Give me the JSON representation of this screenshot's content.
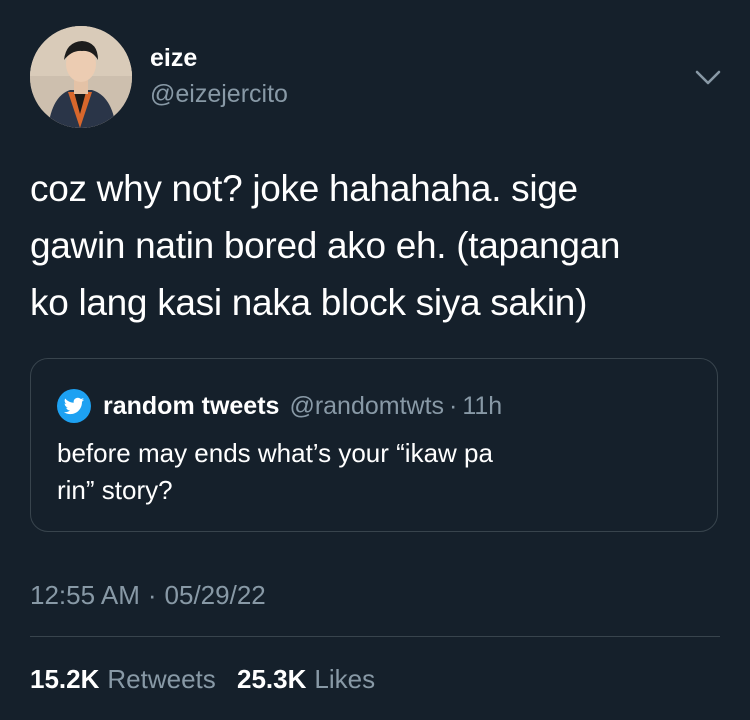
{
  "author": {
    "name": "eize",
    "handle": "@eizejercito"
  },
  "tweet": {
    "lines": [
      "coz why not? joke hahahaha. sige",
      "gawin natin bored ako eh. (tapangan",
      "ko lang kasi naka block siya sakin)"
    ]
  },
  "quoted": {
    "name": "random tweets",
    "handle": "@randomtwts",
    "separator": "·",
    "time": "11h",
    "lines": [
      "before may ends what’s your “ikaw pa",
      "rin” story?"
    ]
  },
  "meta": {
    "time": "12:55 AM",
    "separator": "·",
    "date": "05/29/22"
  },
  "stats": {
    "retweets_count": "15.2K",
    "retweets_label": "Retweets",
    "likes_count": "25.3K",
    "likes_label": "Likes"
  },
  "icons": {
    "more": "chevron-down-icon",
    "quote_avatar": "twitter-bird-icon"
  },
  "colors": {
    "background": "#15202b",
    "secondary_text": "#8899a6",
    "border": "#38444d",
    "accent": "#1da1f2"
  }
}
